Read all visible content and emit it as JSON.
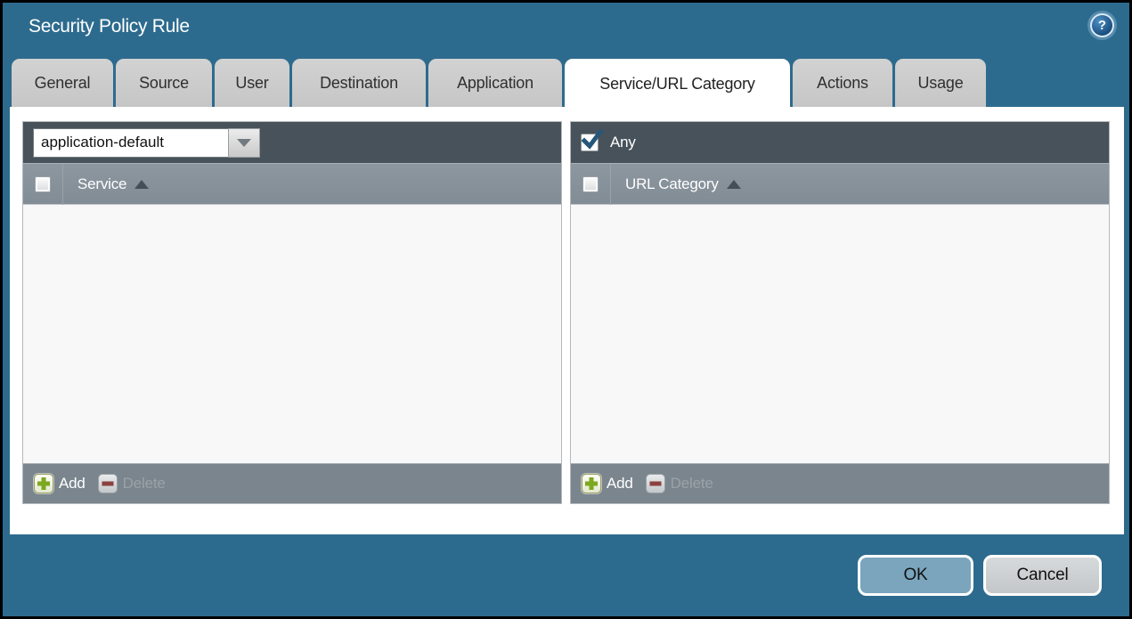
{
  "window": {
    "title": "Security Policy Rule"
  },
  "icons": {
    "help": "?",
    "sort_ascending": "triangle-up-icon",
    "dropdown_arrow": "triangle-down-icon",
    "add": "green-plus-icon",
    "delete": "red-minus-icon",
    "any_check": "checkmark-icon"
  },
  "tabs": [
    {
      "label": "General",
      "active": false
    },
    {
      "label": "Source",
      "active": false
    },
    {
      "label": "User",
      "active": false
    },
    {
      "label": "Destination",
      "active": false
    },
    {
      "label": "Application",
      "active": false
    },
    {
      "label": "Service/URL Category",
      "active": true
    },
    {
      "label": "Actions",
      "active": false
    },
    {
      "label": "Usage",
      "active": false
    }
  ],
  "service_panel": {
    "dropdown_value": "application-default",
    "column_header": "Service",
    "rows": [],
    "add_label": "Add",
    "delete_label": "Delete",
    "delete_enabled": false
  },
  "url_category_panel": {
    "any_label": "Any",
    "any_checked": true,
    "column_header": "URL Category",
    "rows": [],
    "add_label": "Add",
    "delete_label": "Delete",
    "delete_enabled": false
  },
  "footer": {
    "ok_label": "OK",
    "cancel_label": "Cancel"
  },
  "colors": {
    "background_teal": "#2d6b8e",
    "toolbar_dark": "#47525a",
    "header_gray": "#87919a",
    "footer_bar_gray": "#7b858d",
    "tab_gray": "#cbcbcb",
    "ok_button_blue": "#7aa5bd",
    "add_icon_green": "#7da81f",
    "delete_icon_red": "#8d4040",
    "check_blue": "#26577a"
  }
}
